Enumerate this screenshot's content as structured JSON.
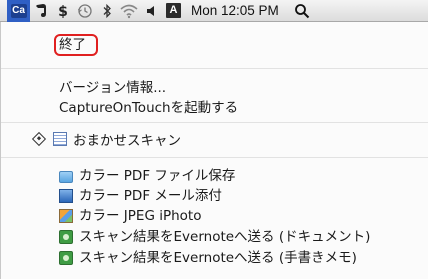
{
  "menubar": {
    "app_icon_label": "Ca",
    "icons": [
      "evernote-icon",
      "dollar-sign-icon",
      "time-machine-icon",
      "bluetooth-icon",
      "wifi-icon",
      "volume-icon"
    ],
    "input_method_label": "A",
    "clock": "Mon 12:05 PM",
    "spotlight_icon": "search-icon"
  },
  "menu": {
    "quit_label": "終了",
    "version_label": "バージョン情報...",
    "launch_label": "CaptureOnTouchを起動する",
    "auto_scan_label": "おまかせスキャン",
    "jobs": [
      {
        "label": "カラー PDF ファイル保存",
        "icon": "folder-icon"
      },
      {
        "label": "カラー PDF メール添付",
        "icon": "mail-attachment-icon"
      },
      {
        "label": "カラー JPEG iPhoto",
        "icon": "iphoto-icon"
      },
      {
        "label": "スキャン結果をEvernoteへ送る (ドキュメント)",
        "icon": "evernote-icon"
      },
      {
        "label": "スキャン結果をEvernoteへ送る (手書きメモ)",
        "icon": "evernote-icon"
      }
    ]
  },
  "colors": {
    "highlight_box": "#e02020",
    "menubar_selected": "#2f5fc4"
  }
}
